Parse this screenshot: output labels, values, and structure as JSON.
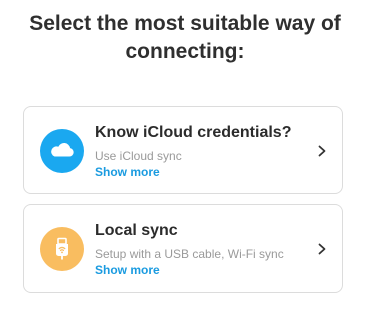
{
  "heading": {
    "line1": "Select the most suitable way of",
    "line2": "connecting:"
  },
  "options": [
    {
      "title": "Know iCloud credentials?",
      "description": "Use iCloud sync",
      "link": "Show more",
      "icon": "cloud-icon",
      "icon_color": "#1aa8f0"
    },
    {
      "title": "Local sync",
      "description": "Setup with a USB cable, Wi-Fi sync",
      "link": "Show more",
      "icon": "usb-wifi-icon",
      "icon_color": "#f9bd60"
    }
  ],
  "colors": {
    "link": "#1a9be0",
    "card_border": "#dcdcdc",
    "title_text": "#2b2b2b",
    "description_text": "#9a9a9a"
  }
}
